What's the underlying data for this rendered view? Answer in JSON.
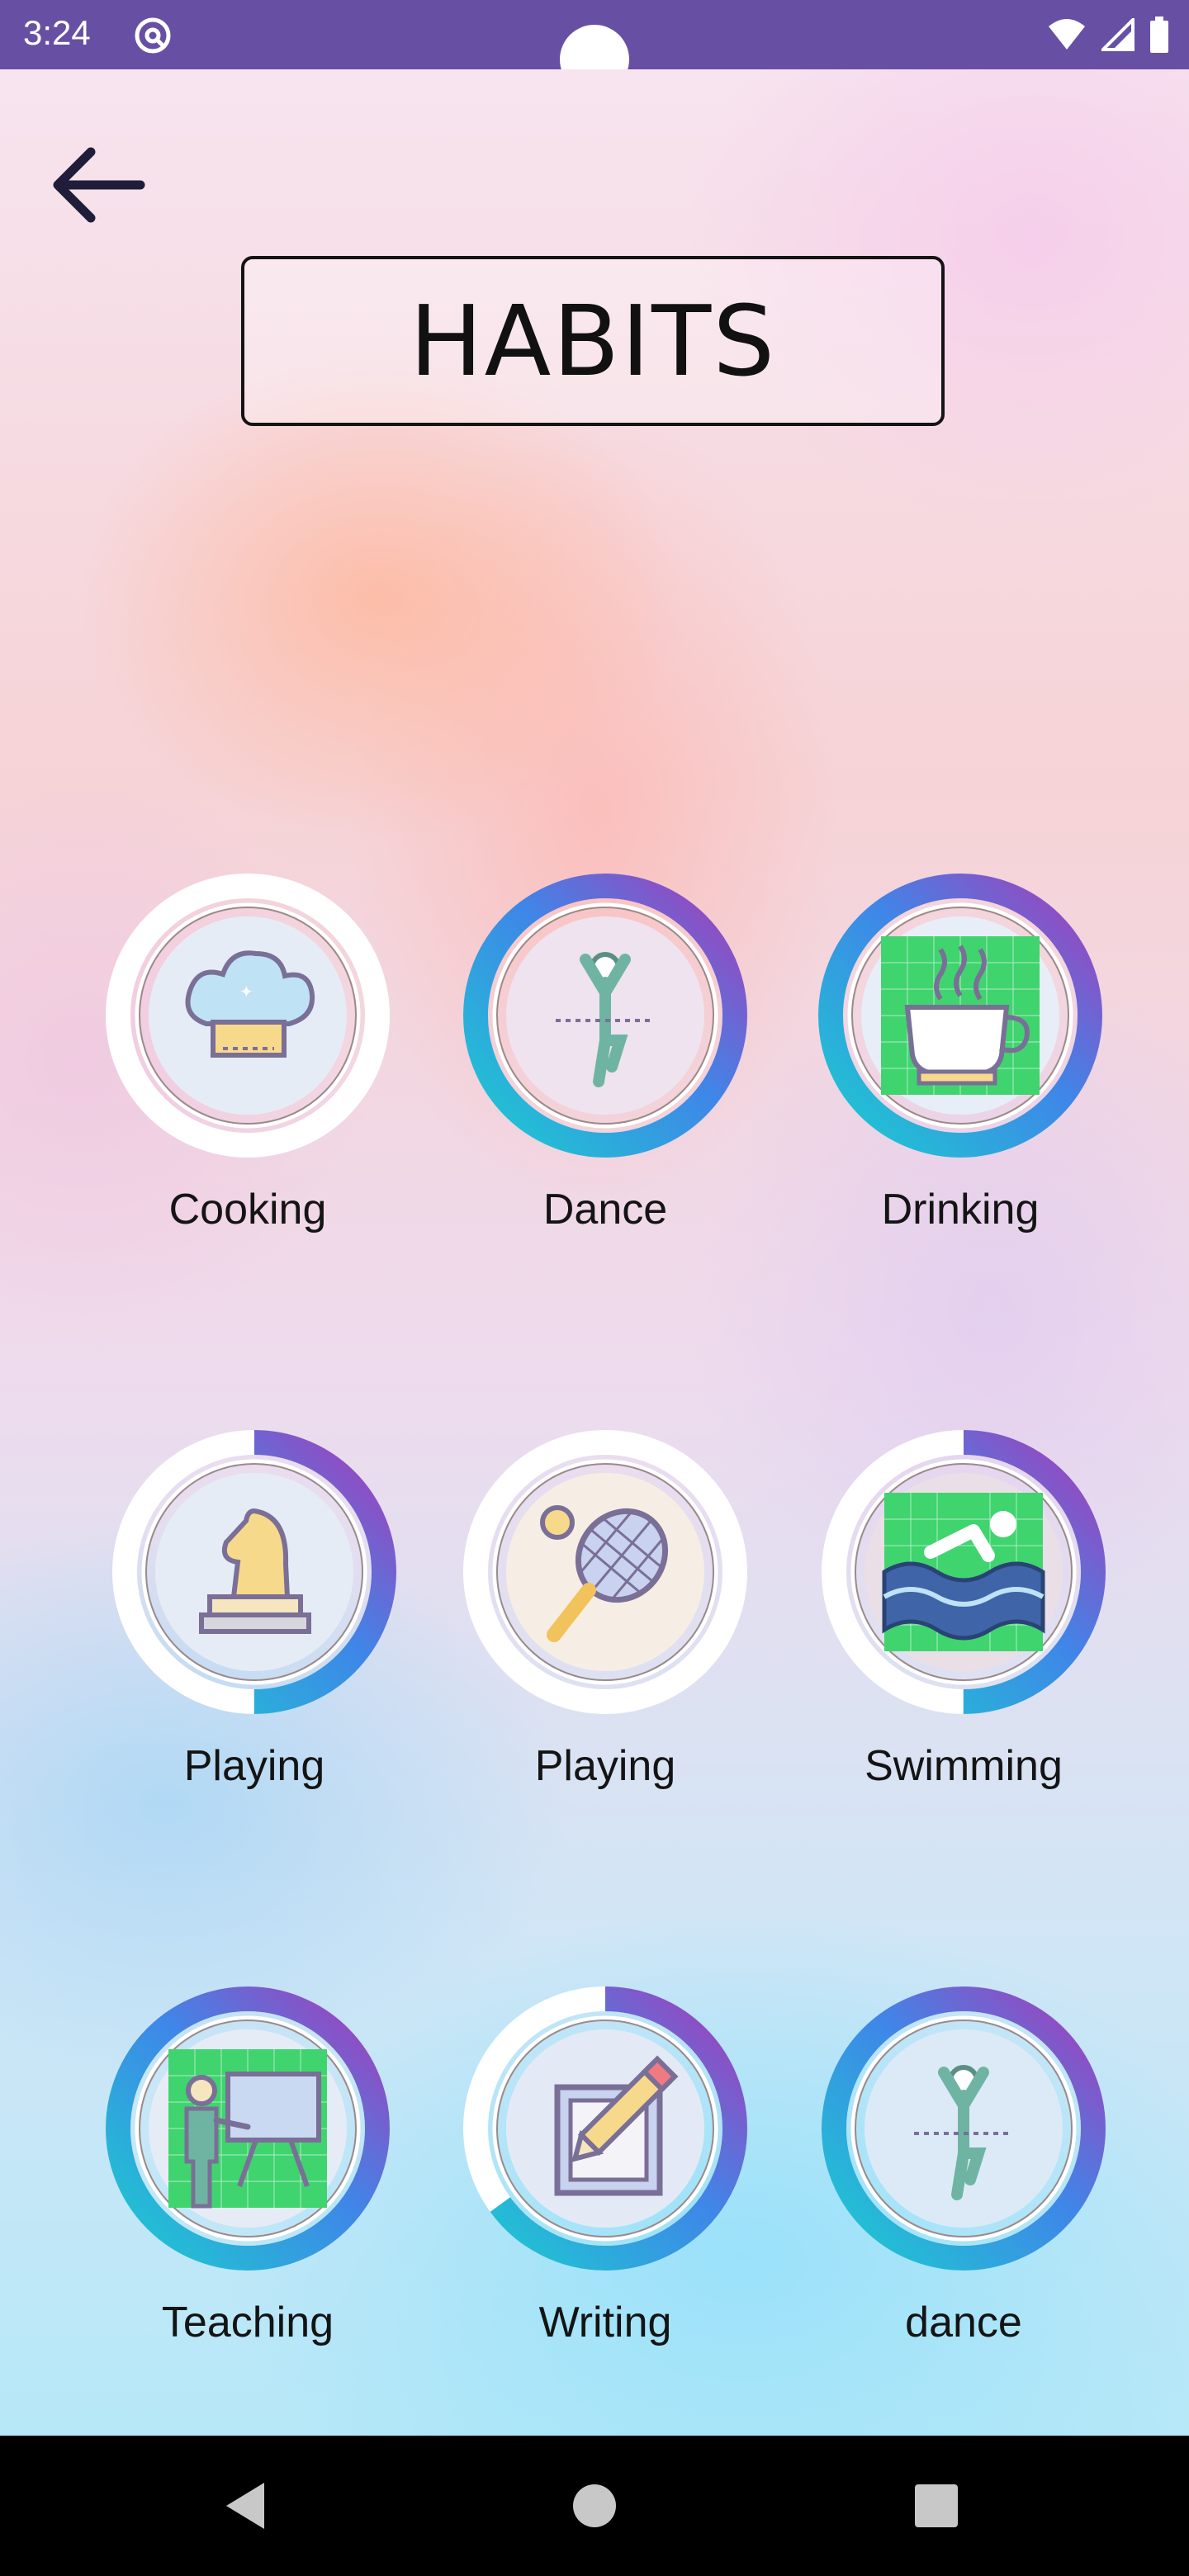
{
  "status_bar": {
    "time": "3:24",
    "icons": [
      "at-sign-icon",
      "wifi-icon",
      "signal-icon",
      "battery-icon"
    ]
  },
  "header": {
    "back_icon": "arrow-left-icon",
    "title": "HABITS"
  },
  "habits": [
    {
      "label": "Cooking",
      "icon": "chef-hat-icon",
      "progress": 0.0
    },
    {
      "label": "Dance",
      "icon": "dancer-icon",
      "progress": 1.0
    },
    {
      "label": "Drinking",
      "icon": "coffee-cup-icon",
      "progress": 1.0
    },
    {
      "label": "Playing",
      "icon": "chess-knight-icon",
      "progress": 0.5
    },
    {
      "label": "Playing",
      "icon": "tennis-racket-icon",
      "progress": 0.0
    },
    {
      "label": "Swimming",
      "icon": "swimmer-icon",
      "progress": 0.5
    },
    {
      "label": "Teaching",
      "icon": "teacher-board-icon",
      "progress": 1.0
    },
    {
      "label": "Writing",
      "icon": "pencil-paper-icon",
      "progress": 0.65
    },
    {
      "label": "dance",
      "icon": "dancer-icon",
      "progress": 1.0
    }
  ],
  "nav_bar": {
    "icons": [
      "back-triangle-icon",
      "home-circle-icon",
      "recents-square-icon"
    ]
  },
  "colors": {
    "status_bar": "#6750a4",
    "ring_purple": "#a63db8",
    "ring_teal": "#1ccbd0",
    "ring_blue": "#3f86e8",
    "icon_green_bg": "#3fd46e"
  }
}
